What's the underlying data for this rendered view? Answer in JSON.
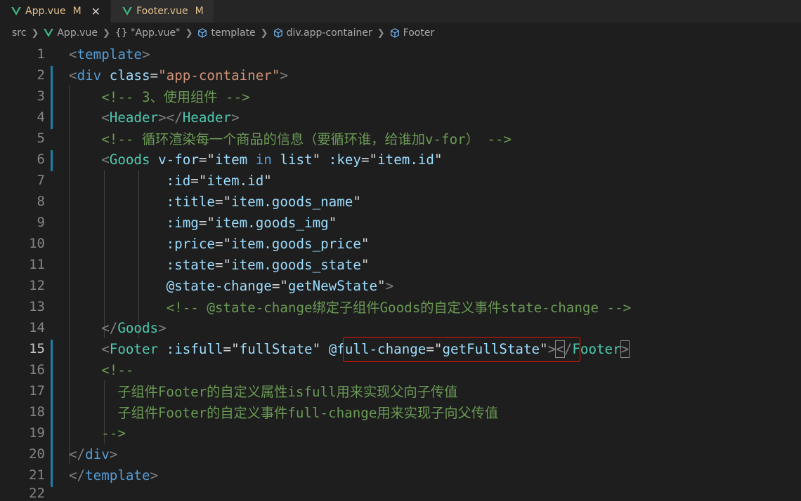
{
  "tabs": [
    {
      "label": "App.vue",
      "status": "M",
      "active": true
    },
    {
      "label": "Footer.vue",
      "status": "M",
      "active": false
    }
  ],
  "breadcrumb": [
    "src",
    "App.vue",
    "{} \"App.vue\"",
    "template",
    "div.app-container",
    "Footer"
  ],
  "lines": [
    {
      "n": "1"
    },
    {
      "n": "2"
    },
    {
      "n": "3"
    },
    {
      "n": "4"
    },
    {
      "n": "5"
    },
    {
      "n": "6"
    },
    {
      "n": "7"
    },
    {
      "n": "8"
    },
    {
      "n": "9"
    },
    {
      "n": "10"
    },
    {
      "n": "11"
    },
    {
      "n": "12"
    },
    {
      "n": "13"
    },
    {
      "n": "14"
    },
    {
      "n": "15"
    },
    {
      "n": "16"
    },
    {
      "n": "17"
    },
    {
      "n": "18"
    },
    {
      "n": "19"
    },
    {
      "n": "20"
    },
    {
      "n": "21"
    },
    {
      "n": "22"
    }
  ],
  "code": {
    "l1_tag": "template",
    "l2_tag": "div",
    "l2_attr": "class",
    "l2_val": "\"app-container\"",
    "l3_comment": "<!-- 3、使用组件 -->",
    "l4_open": "Header",
    "l4_close": "Header",
    "l5_comment": "<!-- 循环渲染每一个商品的信息（要循环谁，给谁加v-for） -->",
    "l6_tag": "Goods",
    "l6_attr": "v-for",
    "l6_item": "item",
    "l6_in": "in",
    "l6_list": "list",
    "l6_key": ":key",
    "l6_keyval": "item.id",
    "l7_attr": ":id",
    "l7_val": "item.id",
    "l8_attr": ":title",
    "l8_val": "item.goods_name",
    "l9_attr": ":img",
    "l9_val": "item.goods_img",
    "l10_attr": ":price",
    "l10_val": "item.goods_price",
    "l11_attr": ":state",
    "l11_val": "item.goods_state",
    "l12_attr": "@state-change",
    "l12_val": "getNewState",
    "l13_comment": "<!-- @state-change绑定子组件Goods的自定义事件state-change -->",
    "l14_tag": "Goods",
    "l15_tag": "Footer",
    "l15_attr": ":isfull",
    "l15_val": "fullState",
    "l15_attr2": "@full-change",
    "l15_val2": "getFullState",
    "l15_close": "Footer",
    "l16_comment": "<!--",
    "l17_comment": "子组件Footer的自定义属性isfull用来实现父向子传值",
    "l18_comment": "子组件Footer的自定义事件full-change用来实现子向父传值",
    "l19_comment": "-->",
    "l20_tag": "div",
    "l21_tag": "template"
  },
  "colors": {
    "highlight_box": "#e51400",
    "vue_green": "#41b883"
  },
  "icons": [
    "vue-icon",
    "close-icon",
    "chevron-right-icon",
    "braces-icon",
    "cube-icon"
  ]
}
